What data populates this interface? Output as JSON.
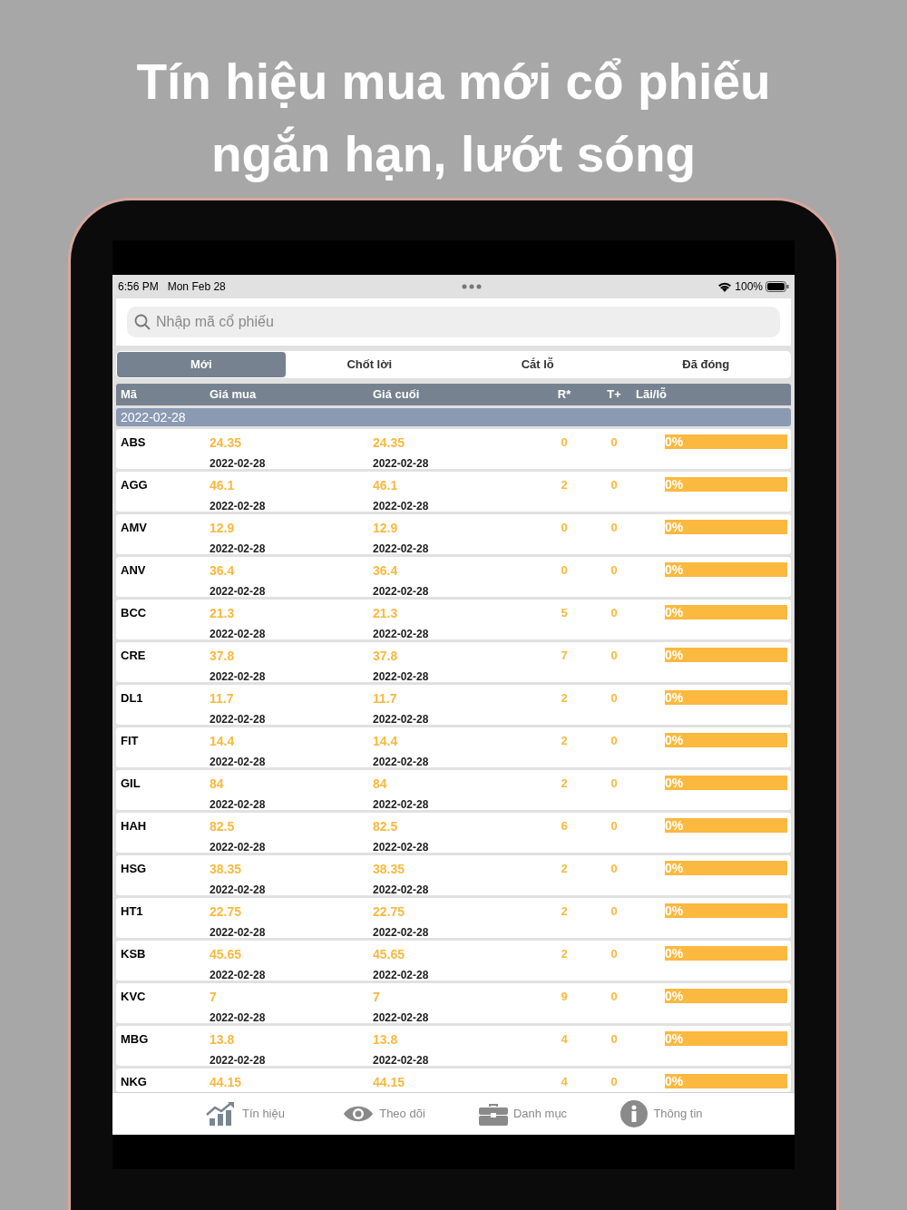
{
  "headline": [
    "Tín hiệu mua mới cổ phiếu",
    "ngắn hạn, lướt sóng"
  ],
  "status_bar": {
    "time": "6:56 PM",
    "date": "Mon Feb 28",
    "battery": "100%"
  },
  "search": {
    "placeholder": "Nhập mã cổ phiếu"
  },
  "tabs": [
    {
      "label": "Mới",
      "selected": true
    },
    {
      "label": "Chốt lời",
      "selected": false
    },
    {
      "label": "Cắt lỗ",
      "selected": false
    },
    {
      "label": "Đã đóng",
      "selected": false
    }
  ],
  "table": {
    "columns": [
      "Mã",
      "Giá mua",
      "Giá cuối",
      "R*",
      "T+",
      "Lãi/lỗ"
    ],
    "group": "2022-02-28",
    "rows": [
      {
        "code": "ABS",
        "buy": "24.35",
        "buy_date": "2022-02-28",
        "last": "24.35",
        "last_date": "2022-02-28",
        "r": "0",
        "t": "0",
        "pl": "0%"
      },
      {
        "code": "AGG",
        "buy": "46.1",
        "buy_date": "2022-02-28",
        "last": "46.1",
        "last_date": "2022-02-28",
        "r": "2",
        "t": "0",
        "pl": "0%"
      },
      {
        "code": "AMV",
        "buy": "12.9",
        "buy_date": "2022-02-28",
        "last": "12.9",
        "last_date": "2022-02-28",
        "r": "0",
        "t": "0",
        "pl": "0%"
      },
      {
        "code": "ANV",
        "buy": "36.4",
        "buy_date": "2022-02-28",
        "last": "36.4",
        "last_date": "2022-02-28",
        "r": "0",
        "t": "0",
        "pl": "0%"
      },
      {
        "code": "BCC",
        "buy": "21.3",
        "buy_date": "2022-02-28",
        "last": "21.3",
        "last_date": "2022-02-28",
        "r": "5",
        "t": "0",
        "pl": "0%"
      },
      {
        "code": "CRE",
        "buy": "37.8",
        "buy_date": "2022-02-28",
        "last": "37.8",
        "last_date": "2022-02-28",
        "r": "7",
        "t": "0",
        "pl": "0%"
      },
      {
        "code": "DL1",
        "buy": "11.7",
        "buy_date": "2022-02-28",
        "last": "11.7",
        "last_date": "2022-02-28",
        "r": "2",
        "t": "0",
        "pl": "0%"
      },
      {
        "code": "FIT",
        "buy": "14.4",
        "buy_date": "2022-02-28",
        "last": "14.4",
        "last_date": "2022-02-28",
        "r": "2",
        "t": "0",
        "pl": "0%"
      },
      {
        "code": "GIL",
        "buy": "84",
        "buy_date": "2022-02-28",
        "last": "84",
        "last_date": "2022-02-28",
        "r": "2",
        "t": "0",
        "pl": "0%"
      },
      {
        "code": "HAH",
        "buy": "82.5",
        "buy_date": "2022-02-28",
        "last": "82.5",
        "last_date": "2022-02-28",
        "r": "6",
        "t": "0",
        "pl": "0%"
      },
      {
        "code": "HSG",
        "buy": "38.35",
        "buy_date": "2022-02-28",
        "last": "38.35",
        "last_date": "2022-02-28",
        "r": "2",
        "t": "0",
        "pl": "0%"
      },
      {
        "code": "HT1",
        "buy": "22.75",
        "buy_date": "2022-02-28",
        "last": "22.75",
        "last_date": "2022-02-28",
        "r": "2",
        "t": "0",
        "pl": "0%"
      },
      {
        "code": "KSB",
        "buy": "45.65",
        "buy_date": "2022-02-28",
        "last": "45.65",
        "last_date": "2022-02-28",
        "r": "2",
        "t": "0",
        "pl": "0%"
      },
      {
        "code": "KVC",
        "buy": "7",
        "buy_date": "2022-02-28",
        "last": "7",
        "last_date": "2022-02-28",
        "r": "9",
        "t": "0",
        "pl": "0%"
      },
      {
        "code": "MBG",
        "buy": "13.8",
        "buy_date": "2022-02-28",
        "last": "13.8",
        "last_date": "2022-02-28",
        "r": "4",
        "t": "0",
        "pl": "0%"
      },
      {
        "code": "NKG",
        "buy": "44.15",
        "last": "44.15",
        "r": "4",
        "t": "0",
        "pl": "0%"
      }
    ]
  },
  "nav": [
    {
      "kind": "chart",
      "label": "Tín hiệu"
    },
    {
      "kind": "eye",
      "label": "Theo dõi"
    },
    {
      "kind": "briefcase",
      "label": "Danh mục"
    },
    {
      "kind": "info",
      "label": "Thông tin"
    }
  ]
}
